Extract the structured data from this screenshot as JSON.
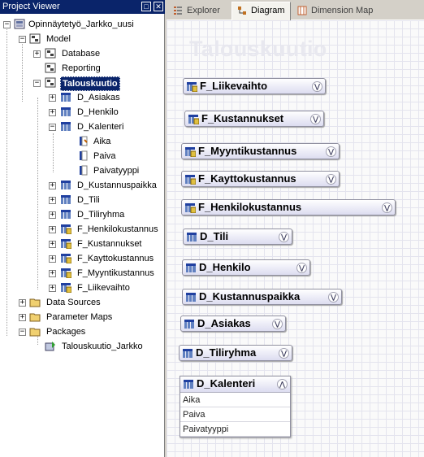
{
  "project_viewer": {
    "title": "Project Viewer",
    "title_buttons": [
      "□",
      "✕"
    ],
    "tree": {
      "root": "Opinnäytetyö_Jarkko_uusi",
      "model": "Model",
      "database": "Database",
      "reporting": "Reporting",
      "selected_namespace": "Talouskuutio",
      "namespace_items": [
        "D_Asiakas",
        "D_Henkilo",
        "D_Kalenteri"
      ],
      "kalenteri_items": [
        "Aika",
        "Paiva",
        "Paivatyyppi"
      ],
      "namespace_items_after": [
        "D_Kustannuspaikka",
        "D_Tili",
        "D_Tiliryhma",
        "F_Henkilokustannus",
        "F_Kustannukset",
        "F_Kayttokustannus",
        "F_Myyntikustannus",
        "F_Liikevaihto"
      ],
      "data_sources": "Data Sources",
      "parameter_maps": "Parameter Maps",
      "packages": "Packages",
      "package_item": "Talouskuutio_Jarkko"
    }
  },
  "tabs": [
    {
      "label": "Explorer",
      "icon": "explorer-icon",
      "active": false
    },
    {
      "label": "Diagram",
      "icon": "diagram-icon",
      "active": true
    },
    {
      "label": "Dimension Map",
      "icon": "dimension-map-icon",
      "active": false
    }
  ],
  "diagram": {
    "title": "Talouskuutio",
    "entities": [
      {
        "label": "F_Liikevaihto",
        "kind": "fact"
      },
      {
        "label": "F_Kustannukset",
        "kind": "fact"
      },
      {
        "label": "F_Myyntikustannus",
        "kind": "fact"
      },
      {
        "label": "F_Kayttokustannus",
        "kind": "fact"
      },
      {
        "label": "F_Henkilokustannus",
        "kind": "fact"
      },
      {
        "label": "D_Tili",
        "kind": "dimension"
      },
      {
        "label": "D_Henkilo",
        "kind": "dimension"
      },
      {
        "label": "D_Kustannuspaikka",
        "kind": "dimension"
      },
      {
        "label": "D_Asiakas",
        "kind": "dimension"
      },
      {
        "label": "D_Tiliryhma",
        "kind": "dimension"
      }
    ],
    "expanded_entity": {
      "label": "D_Kalenteri",
      "items": [
        "Aika",
        "Paiva",
        "Paivatyyppi"
      ]
    }
  },
  "colors": {
    "title_bar": "#0a246a",
    "selection": "#0a246a",
    "chrome": "#d4d0c8"
  }
}
